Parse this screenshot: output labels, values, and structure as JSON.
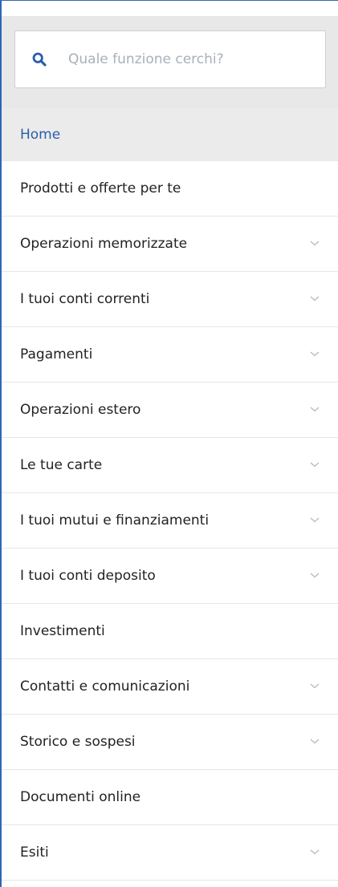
{
  "search": {
    "placeholder": "Quale funzione cerchi?",
    "icon": "search-icon"
  },
  "colors": {
    "accent": "#2c5ea8",
    "home_bg": "#ebebeb",
    "search_bg": "#e8e8e8"
  },
  "menu": {
    "items": [
      {
        "label": "Home",
        "expandable": false,
        "active": true
      },
      {
        "label": "Prodotti e offerte per te",
        "expandable": false
      },
      {
        "label": "Operazioni memorizzate",
        "expandable": true
      },
      {
        "label": "I tuoi conti correnti",
        "expandable": true
      },
      {
        "label": "Pagamenti",
        "expandable": true
      },
      {
        "label": "Operazioni estero",
        "expandable": true
      },
      {
        "label": "Le tue carte",
        "expandable": true
      },
      {
        "label": "I tuoi mutui e finanziamenti",
        "expandable": true
      },
      {
        "label": "I tuoi conti deposito",
        "expandable": true
      },
      {
        "label": "Investimenti",
        "expandable": false
      },
      {
        "label": "Contatti e comunicazioni",
        "expandable": true
      },
      {
        "label": "Storico e sospesi",
        "expandable": true
      },
      {
        "label": "Documenti online",
        "expandable": false
      },
      {
        "label": "Esiti",
        "expandable": true
      }
    ]
  }
}
